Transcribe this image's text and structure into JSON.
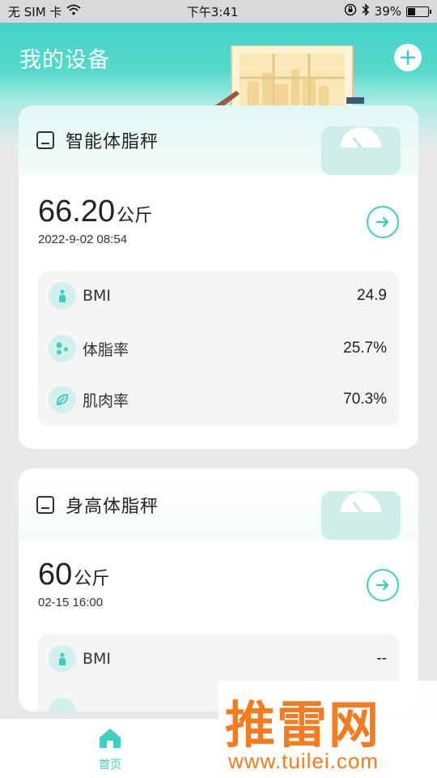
{
  "status_bar": {
    "carrier": "无 SIM 卡",
    "time": "下午3:41",
    "battery": "39%"
  },
  "header": {
    "title": "我的设备"
  },
  "devices": [
    {
      "name": "智能体脂秤",
      "weight": "66.20",
      "unit": "公斤",
      "time": "2022-9-02 08:54",
      "metrics": [
        {
          "label": "BMI",
          "value": "24.9",
          "icon": "person-icon"
        },
        {
          "label": "体脂率",
          "value": "25.7%",
          "icon": "molecule-icon"
        },
        {
          "label": "肌肉率",
          "value": "70.3%",
          "icon": "leaf-icon"
        }
      ]
    },
    {
      "name": "身高体脂秤",
      "weight": "60",
      "unit": "公斤",
      "time": "02-15 16:00",
      "metrics": [
        {
          "label": "BMI",
          "value": "--",
          "icon": "person-icon"
        }
      ]
    }
  ],
  "bottom_nav": {
    "home_label": "首页"
  },
  "watermark": {
    "text": "推雷网",
    "url": "www.tuilei.com"
  },
  "colors": {
    "accent": "#3fcfbf",
    "header_gradient_top": "#3fd3c6",
    "watermark": "#f47b20"
  }
}
